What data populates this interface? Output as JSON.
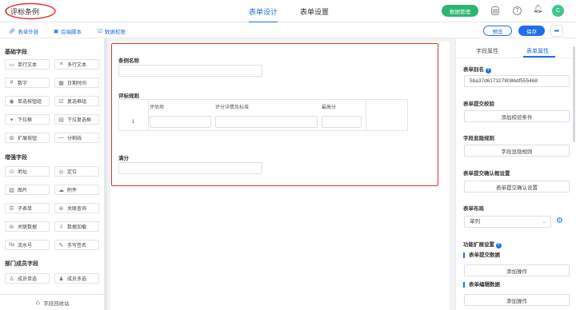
{
  "header": {
    "back_icon": "chevron-left-icon",
    "title": "评标条例",
    "tabs": [
      {
        "label": "表单设计",
        "active": true
      },
      {
        "label": "表单设置",
        "active": false
      }
    ],
    "data_manage_label": "数据管理",
    "icons": [
      "doc-icon",
      "help-icon",
      "bell-icon"
    ],
    "avatar_letter": "C",
    "accent": "#1f6fe8",
    "green": "#2bb673"
  },
  "subbar": {
    "links": [
      {
        "icon": "link-icon",
        "label": "表单外链"
      },
      {
        "icon": "script-icon",
        "label": "后端脚本"
      },
      {
        "icon": "permission-icon",
        "label": "数据权限"
      }
    ],
    "preview_label": "预览",
    "save_label": "保存",
    "share_icon": "share-icon"
  },
  "left": {
    "basic_title": "基础字段",
    "basic": [
      {
        "icon": "single-line-icon",
        "label": "单行文本"
      },
      {
        "icon": "multi-line-icon",
        "label": "多行文本"
      },
      {
        "icon": "number-icon",
        "label": "数字"
      },
      {
        "icon": "datetime-icon",
        "label": "日期时间"
      },
      {
        "icon": "radio-icon",
        "label": "单选按钮组"
      },
      {
        "icon": "checkbox-icon",
        "label": "复选框组"
      },
      {
        "icon": "dropdown-icon",
        "label": "下拉框"
      },
      {
        "icon": "multi-dropdown-icon",
        "label": "下拉复选框"
      },
      {
        "icon": "extend-icon",
        "label": "扩展按钮"
      },
      {
        "icon": "divider-icon",
        "label": "分割线"
      }
    ],
    "enhanced_title": "增强字段",
    "enhanced": [
      {
        "icon": "location-icon",
        "label": "地址"
      },
      {
        "icon": "position-icon",
        "label": "定位"
      },
      {
        "icon": "image-icon",
        "label": "图片"
      },
      {
        "icon": "attachment-icon",
        "label": "附件"
      },
      {
        "icon": "subform-icon",
        "label": "子表单"
      },
      {
        "icon": "related-query-icon",
        "label": "关联查询"
      },
      {
        "icon": "related-data-icon",
        "label": "关联数据"
      },
      {
        "icon": "data-load-icon",
        "label": "数据加载"
      },
      {
        "icon": "serial-icon",
        "label": "流水号"
      },
      {
        "icon": "signature-icon",
        "label": "手写签名"
      }
    ],
    "dept_title": "部门成员字段",
    "dept": [
      {
        "icon": "member-single-icon",
        "label": "成员单选"
      },
      {
        "icon": "member-multi-icon",
        "label": "成员多选"
      }
    ],
    "recycle_label": "字段回收站"
  },
  "canvas": {
    "field1_label": "条例名称",
    "field2_label": "评标规则",
    "table_headers": [
      "评估项",
      "评分详情及标准",
      "最高分"
    ],
    "row_index": "1",
    "field3_label": "满分",
    "highlight_color": "#e0332f"
  },
  "right": {
    "tabs": [
      {
        "label": "字段属性",
        "active": false
      },
      {
        "label": "表单属性",
        "active": true
      }
    ],
    "alias_label": "表单别名",
    "alias_value": "5ba37d6173278086df555468",
    "submit_check_label": "表单提交校验",
    "submit_check_btn": "添加校验条件",
    "visibility_label": "字段显隐规则",
    "visibility_btn": "字段显隐规则",
    "confirm_label": "表单提交确认框设置",
    "confirm_btn": "表单提交确认设置",
    "layout_label": "表单布局",
    "layout_value": "单列",
    "ext_label": "功能扩展设置",
    "submit_data_label": "表单提交数据",
    "submit_data_btn": "添加操作",
    "edit_data_label": "表单编辑数据",
    "edit_data_btn": "添加操作"
  }
}
